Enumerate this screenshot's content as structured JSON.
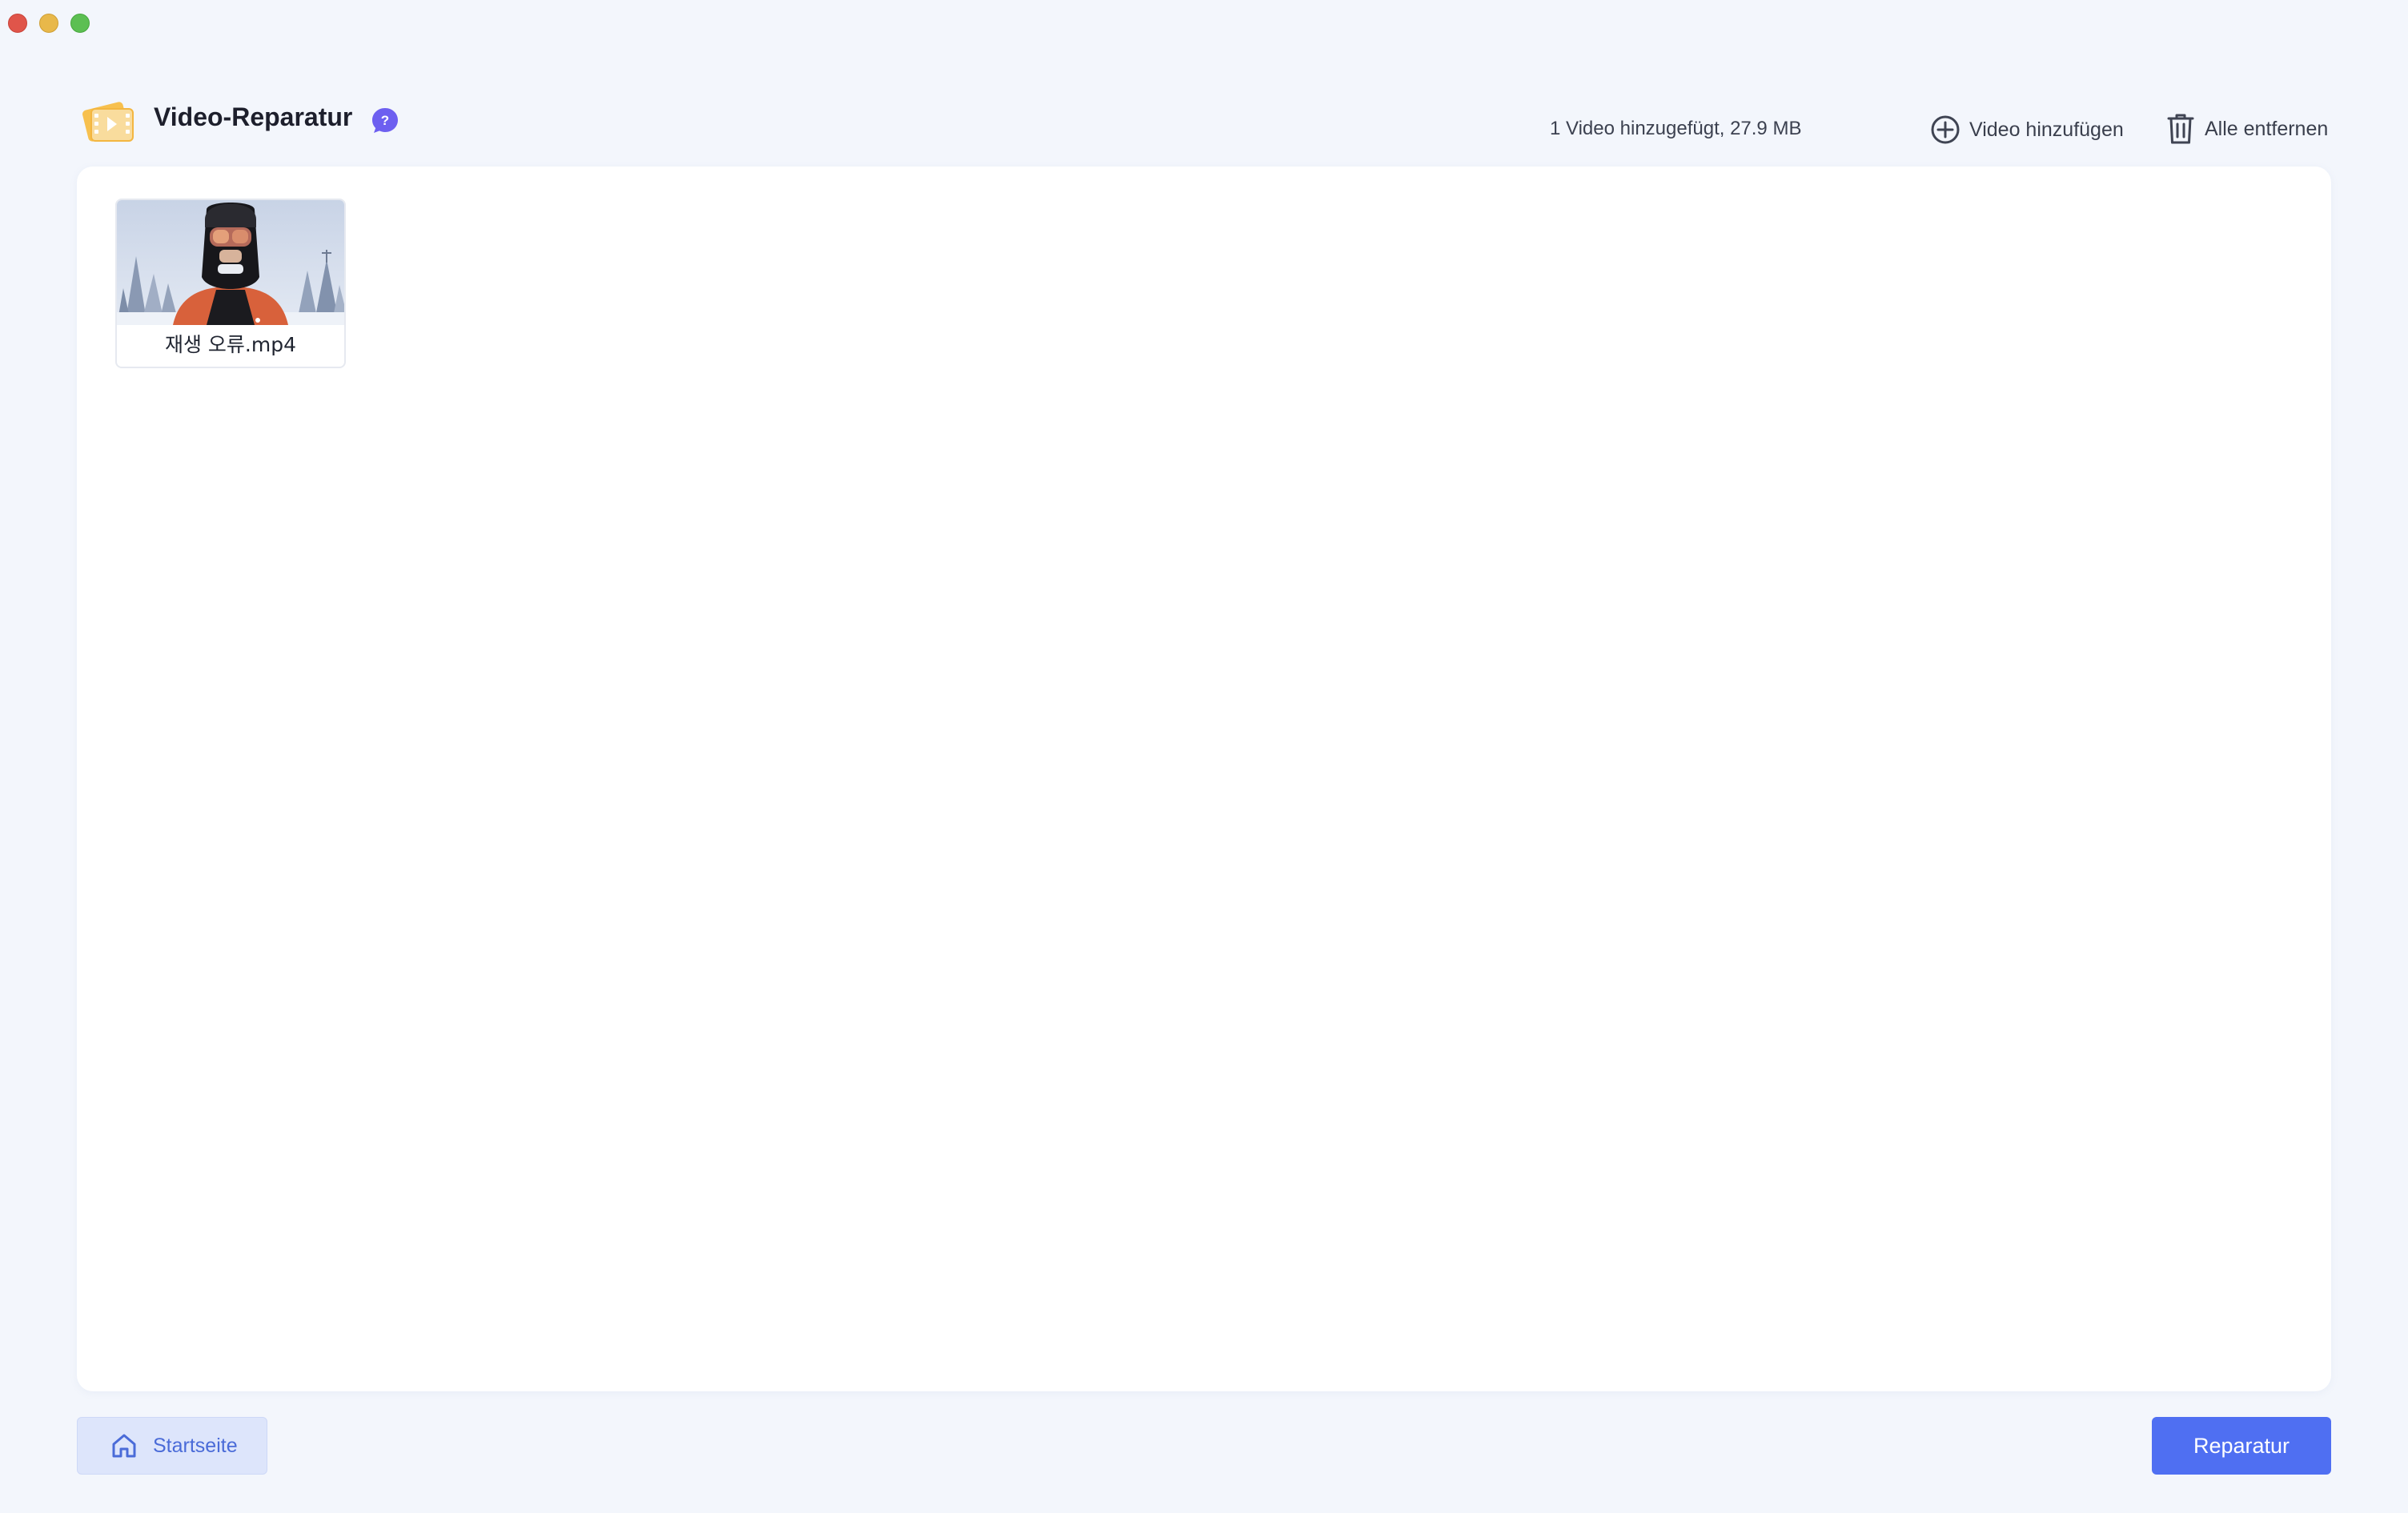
{
  "window": {
    "controls": [
      "close",
      "minimize",
      "maximize"
    ]
  },
  "header": {
    "title": "Video-Reparatur",
    "logo_icon": "video-repair-logo-icon",
    "help_icon": "question-bubble-icon",
    "video_count": "1 Video hinzugefügt, 27.9 MB",
    "add_video_label": "Video hinzufügen",
    "remove_all_label": "Alle entfernen"
  },
  "videos": [
    {
      "name": "재생 오류.mp4",
      "thumbnail": "person-in-helmet-and-goggles-snowy-forest"
    }
  ],
  "footer": {
    "home_label": "Startseite",
    "repair_label": "Reparatur"
  },
  "colors": {
    "accent": "#4f6ff2",
    "background": "#f3f6fc",
    "panel": "#ffffff",
    "home_button_bg": "#dde5fb",
    "help_badge": "#6d5ff0"
  }
}
